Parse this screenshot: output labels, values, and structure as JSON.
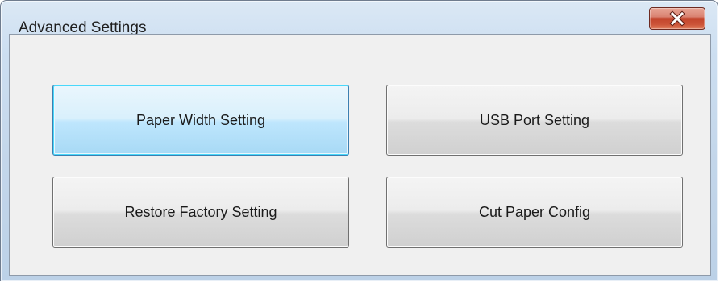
{
  "window": {
    "title": "Advanced Settings",
    "close_icon": "close-icon"
  },
  "buttons": [
    {
      "label": "Paper Width Setting",
      "focused": true
    },
    {
      "label": "USB Port Setting",
      "focused": false
    },
    {
      "label": "Restore Factory Setting",
      "focused": false
    },
    {
      "label": "Cut Paper Config",
      "focused": false
    }
  ],
  "colors": {
    "close_button": "#c2442c",
    "focus_border": "#3c7fb1",
    "client_background": "#f0f0f0"
  }
}
